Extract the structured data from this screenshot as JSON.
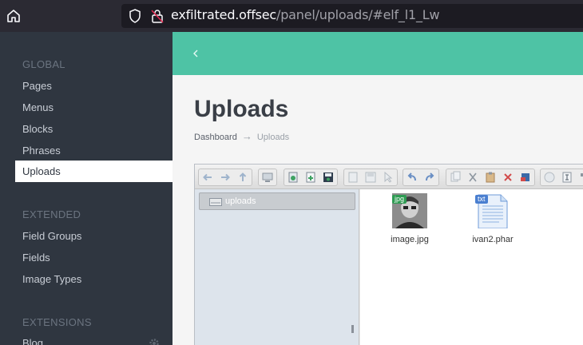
{
  "browser": {
    "url_host": "exfiltrated.offsec",
    "url_path": "/panel/uploads/#elf_l1_Lw"
  },
  "sidebar": {
    "sections": [
      {
        "heading": "GLOBAL",
        "items": [
          "Pages",
          "Menus",
          "Blocks",
          "Phrases",
          "Uploads"
        ]
      },
      {
        "heading": "EXTENDED",
        "items": [
          "Field Groups",
          "Fields",
          "Image Types"
        ]
      },
      {
        "heading": "EXTENSIONS",
        "items": [
          "Blog"
        ]
      }
    ],
    "active_item": "Uploads"
  },
  "main": {
    "title": "Uploads",
    "breadcrumb": {
      "root": "Dashboard",
      "separator": "→",
      "current": "Uploads"
    }
  },
  "finder": {
    "tree_root": "uploads",
    "files": [
      {
        "name": "image.jpg",
        "kind": "jpg",
        "badge_color": "#2e9b52"
      },
      {
        "name": "ivan2.phar",
        "kind": "txt",
        "badge_color": "#4a7fd0"
      }
    ]
  },
  "colors": {
    "accent": "#4ec3a5",
    "sidebar_bg": "#2f3640"
  }
}
